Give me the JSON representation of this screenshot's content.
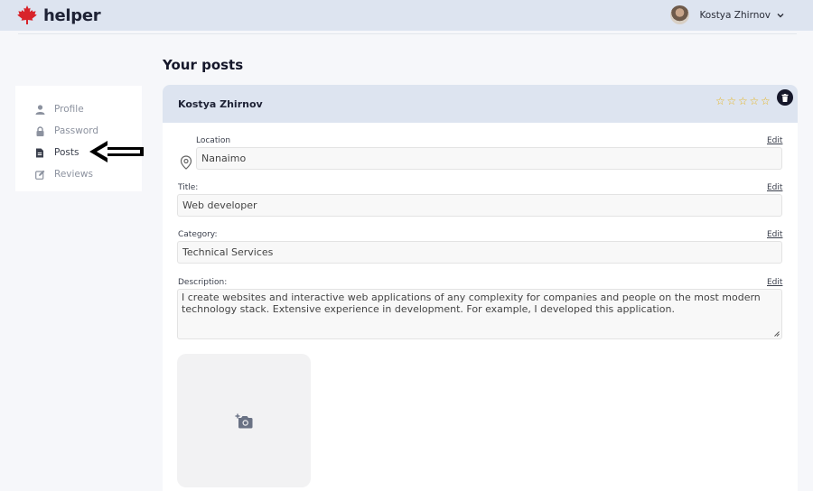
{
  "header": {
    "logo_text": "helper",
    "user_name": "Kostya Zhirnov",
    "brand_color": "#d8232a"
  },
  "sidebar": {
    "items": [
      {
        "label": "Profile",
        "icon": "user-icon"
      },
      {
        "label": "Password",
        "icon": "lock-icon"
      },
      {
        "label": "Posts",
        "icon": "document-icon"
      },
      {
        "label": "Reviews",
        "icon": "edit-icon"
      }
    ],
    "active": "Posts"
  },
  "main": {
    "page_title": "Your posts",
    "post": {
      "author": "Kostya Zhirnov",
      "rating_stars": 5,
      "star_color": "#e7b417",
      "location": {
        "label": "Location",
        "value": "Nanaimo",
        "edit": "Edit"
      },
      "title": {
        "label": "Title:",
        "value": "Web developer",
        "edit": "Edit"
      },
      "category": {
        "label": "Category:",
        "value": "Technical Services",
        "edit": "Edit"
      },
      "description": {
        "label": "Description:",
        "value": "I create websites and interactive web applications of any complexity for companies and people on the most modern technology stack. Extensive experience in development. For example, I developed this application.",
        "edit": "Edit"
      }
    }
  }
}
